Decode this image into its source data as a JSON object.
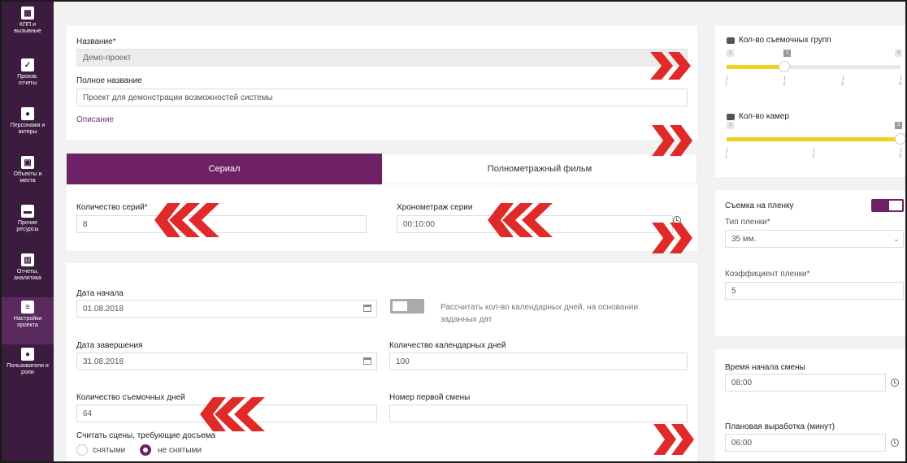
{
  "sidebar": {
    "items": [
      {
        "label": "КПП и вызывные",
        "icon": "calendar-icon"
      },
      {
        "label": "Произв. отчеты",
        "icon": "checkbox-icon"
      },
      {
        "label": "Персонажи и актеры",
        "icon": "people-icon"
      },
      {
        "label": "Объекты и места",
        "icon": "image-icon"
      },
      {
        "label": "Прочие ресурсы",
        "icon": "box-icon"
      },
      {
        "label": "Отчеты, аналитика",
        "icon": "bar-chart-icon"
      },
      {
        "label": "Настройки проекта",
        "icon": "sliders-icon"
      },
      {
        "label": "Пользователи и роли",
        "icon": "users-icon"
      }
    ]
  },
  "project": {
    "name_label": "Название",
    "name_value": "Демо-проект",
    "fullname_label": "Полное название",
    "fullname_value": "Проект для демонстрации возможностей системы",
    "description_link": "Описание",
    "required_mark": "*"
  },
  "tabs": {
    "series": "Сериал",
    "feature": "Полнометражный фильм"
  },
  "series": {
    "count_label": "Количество серий",
    "count_value": "8",
    "duration_label": "Хронометраж серии",
    "duration_value": "00:10:00"
  },
  "dates": {
    "start_label": "Дата начала",
    "start_value": "01.08.2018",
    "end_label": "Дата завершения",
    "end_value": "31.08.2018",
    "calc_toggle_text": "Рассчитать кол-во календарных дней, на основании заданных дат",
    "calendar_days_label": "Количество календарных дней",
    "calendar_days_value": "100",
    "shooting_days_label": "Количество съемочных дней",
    "shooting_days_value": "64",
    "first_shift_label": "Номер первой смены",
    "first_shift_value": "",
    "reshoot_label": "Считать сцены, требующие досъема",
    "radio_shot": "снятыми",
    "radio_not_shot": "не снятыми"
  },
  "groups_slider": {
    "title": "Кол-во съемочных групп",
    "min": "1",
    "max": "4",
    "value": 2,
    "value_label": "2",
    "ticks": [
      "1",
      "2",
      "3",
      "4"
    ]
  },
  "cameras_slider": {
    "title": "Кол-во камер",
    "min": "1",
    "max": "3",
    "value": 3,
    "value_label": "3",
    "ticks": [
      "1",
      "2",
      "3"
    ]
  },
  "film": {
    "toggle_label": "Съемка на пленку",
    "type_label": "Тип пленки",
    "type_value": "35 мм.",
    "coef_label": "Коэффициент пленки",
    "coef_value": "5"
  },
  "shift": {
    "start_label": "Время начала смены",
    "start_value": "08:00",
    "planned_label": "Плановая выработка (минут)",
    "planned_value": "06:00"
  },
  "colors": {
    "accent": "#6e2265",
    "sidebar": "#3b1c3f",
    "arrow": "#e02a2a",
    "slider": "#f2d11e"
  }
}
